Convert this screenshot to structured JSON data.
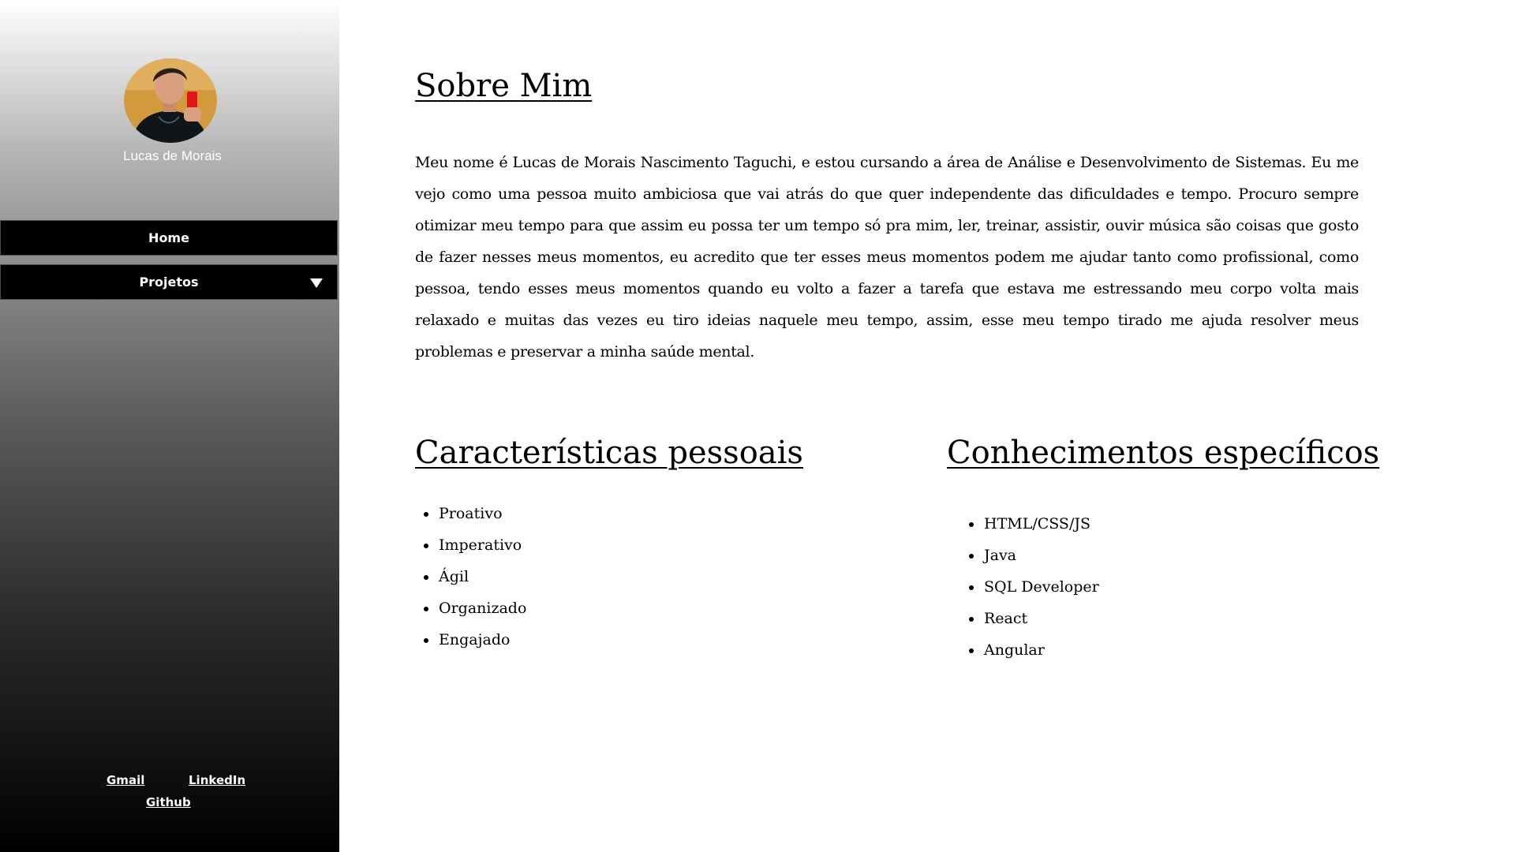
{
  "sidebar": {
    "profile_name": "Lucas de Morais",
    "avatar_icon": "profile-photo",
    "nav": {
      "home_label": "Home",
      "projetos_label": "Projetos",
      "projetos_arrow_icon": "triangle-down-icon"
    },
    "links": {
      "gmail": "Gmail",
      "linkedin": "LinkedIn",
      "github": "Github"
    }
  },
  "main": {
    "about": {
      "title": "Sobre Mim",
      "text": "Meu nome é Lucas de Morais Nascimento Taguchi, e estou cursando a área de Análise e Desenvolvimento de Sistemas. Eu me vejo como uma pessoa muito ambiciosa que vai atrás do que quer independente das dificuldades e tempo. Procuro sempre otimizar meu tempo para que assim eu possa ter um tempo só pra mim, ler, treinar, assistir, ouvir música são coisas que gosto de fazer nesses meus momentos, eu acredito que ter esses meus momentos podem me ajudar tanto como profissional, como pessoa, tendo esses meus momentos quando eu volto a fazer a tarefa que estava me estressando meu corpo volta mais relaxado e muitas das vezes eu tiro ideias naquele meu tempo, assim, esse meu tempo tirado me ajuda resolver meus problemas e preservar a minha saúde mental."
    },
    "traits": {
      "title": "Características pessoais",
      "items": [
        "Proativo",
        "Imperativo",
        "Ágil",
        "Organizado",
        "Engajado"
      ]
    },
    "skills": {
      "title": "Conhecimentos específicos",
      "items": [
        "HTML/CSS/JS",
        "Java",
        "SQL Developer",
        "React",
        "Angular"
      ]
    }
  },
  "colors": {
    "sidebar_top": "#ffffff",
    "sidebar_bottom": "#000000",
    "nav_background": "#000000",
    "text": "#000000"
  }
}
